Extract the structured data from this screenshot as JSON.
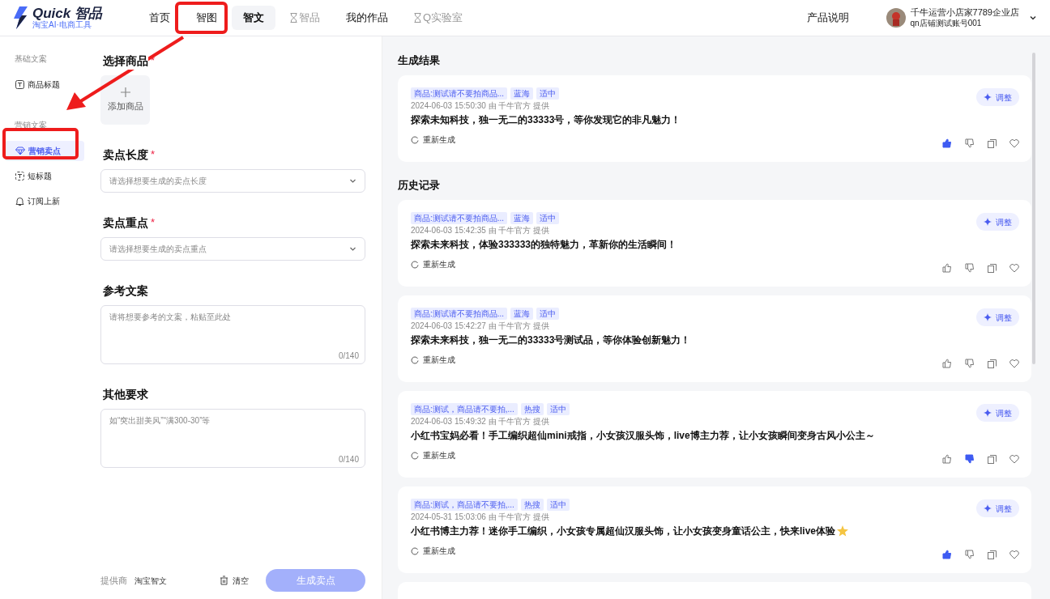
{
  "logo": {
    "name": "Quick 智品",
    "tagline": "淘宝AI·电商工具"
  },
  "nav": [
    {
      "label": "首页",
      "selected": false,
      "disabled": false
    },
    {
      "label": "智图",
      "selected": false,
      "disabled": false
    },
    {
      "label": "智文",
      "selected": true,
      "disabled": false
    },
    {
      "label": "智品",
      "selected": false,
      "disabled": true
    },
    {
      "label": "我的作品",
      "selected": false,
      "disabled": false
    },
    {
      "label": "Q实验室",
      "selected": false,
      "disabled": true
    }
  ],
  "help_link": "产品说明",
  "account": {
    "shop": "千牛运营小店家7789企业店",
    "account": "qn店铺测试账号001"
  },
  "sidebar": {
    "groups": [
      {
        "title": "基础文案",
        "items": [
          {
            "label": "商品标题",
            "kind": "title",
            "selected": false
          }
        ]
      },
      {
        "title": "营销文案",
        "items": [
          {
            "label": "营销卖点",
            "kind": "diamond",
            "selected": true
          },
          {
            "label": "短标题",
            "kind": "short-title",
            "selected": false
          },
          {
            "label": "订阅上新",
            "kind": "bell",
            "selected": false
          }
        ]
      }
    ]
  },
  "form": {
    "product": {
      "label": "选择商品",
      "required_mark": "*",
      "add_label": "添加商品"
    },
    "fields": [
      {
        "kind": "select",
        "label": "卖点长度",
        "required_mark": "*",
        "placeholder": "请选择想要生成的卖点长度"
      },
      {
        "kind": "select",
        "label": "卖点重点",
        "required_mark": "*",
        "placeholder": "请选择想要生成的卖点重点"
      },
      {
        "kind": "textarea",
        "label": "参考文案",
        "placeholder": "请将想要参考的文案，粘贴至此处",
        "counter": "0/140"
      },
      {
        "kind": "textarea",
        "label": "其他要求",
        "placeholder": "如“突出甜美风”“满300-30”等",
        "counter": "0/140"
      }
    ],
    "provider_label": "提供商",
    "provider": "淘宝智文",
    "clear": "清空",
    "submit": {
      "label": "生成卖点",
      "disabled": true
    }
  },
  "results": {
    "title": "生成结果",
    "cards": [
      {
        "tags": [
          "商品:测试请不要拍商品...",
          "蓝海",
          "适中"
        ],
        "meta": "2024-06-03 15:50:30 由 千牛官方 提供",
        "text": "探索未知科技，独一无二的33333号，等你发现它的非凡魅力！",
        "sparkle": false,
        "regenerate": "重新生成",
        "adjust": "调整",
        "liked": true,
        "disliked": false
      }
    ]
  },
  "history": {
    "title": "历史记录",
    "cards": [
      {
        "tags": [
          "商品:测试请不要拍商品...",
          "蓝海",
          "适中"
        ],
        "meta": "2024-06-03 15:42:35 由 千牛官方 提供",
        "text": "探索未来科技，体验333333的独特魅力，革新你的生活瞬间！",
        "sparkle": false,
        "regenerate": "重新生成",
        "adjust": "调整",
        "liked": false,
        "disliked": false
      },
      {
        "tags": [
          "商品:测试请不要拍商品...",
          "蓝海",
          "适中"
        ],
        "meta": "2024-06-03 15:42:27 由 千牛官方 提供",
        "text": "探索未来科技，独一无二的33333号测试品，等你体验创新魅力！",
        "sparkle": false,
        "regenerate": "重新生成",
        "adjust": "调整",
        "liked": false,
        "disliked": false
      },
      {
        "tags": [
          "商品:测试，商品请不要拍,...",
          "热搜",
          "适中"
        ],
        "meta": "2024-06-03 15:49:32 由 千牛官方 提供",
        "text": "小红书宝妈必看！手工编织超仙mini戒指，小女孩汉服头饰，live博主力荐，让小女孩瞬间变身古风小公主～",
        "sparkle": false,
        "regenerate": "重新生成",
        "adjust": "调整",
        "liked": false,
        "disliked": true
      },
      {
        "tags": [
          "商品:测试，商品请不要拍,...",
          "热搜",
          "适中"
        ],
        "meta": "2024-05-31 15:03:06 由 千牛官方 提供",
        "text": "小红书博主力荐！迷你手工编织，小女孩专属超仙汉服头饰，让小女孩变身童话公主，快来live体验",
        "sparkle": true,
        "regenerate": "重新生成",
        "adjust": "调整",
        "liked": true,
        "disliked": false
      }
    ]
  }
}
